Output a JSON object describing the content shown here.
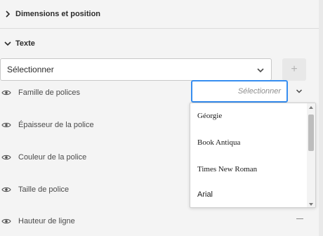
{
  "sections": {
    "dimensions": {
      "label": "Dimensions et position",
      "expanded": false
    },
    "texte": {
      "label": "Texte",
      "expanded": true
    }
  },
  "style_select": {
    "value": "Sélectionner"
  },
  "add_button": {
    "label": "+"
  },
  "properties": [
    {
      "label": "Famille de polices"
    },
    {
      "label": "Épaisseur de la police"
    },
    {
      "label": "Couleur de la police"
    },
    {
      "label": "Taille de police"
    },
    {
      "label": "Hauteur de ligne"
    }
  ],
  "font_family_input": {
    "placeholder": "Sélectionner"
  },
  "font_dropdown": {
    "options": [
      "Géorgie",
      "Book Antiqua",
      "Times New Roman",
      "Arial"
    ]
  },
  "colors": {
    "accent": "#378ef0",
    "background": "#f4f4f4"
  },
  "icons": {
    "section_toggle": "chevron-icon",
    "visibility": "eye-icon",
    "collapse": "minus-icon"
  }
}
